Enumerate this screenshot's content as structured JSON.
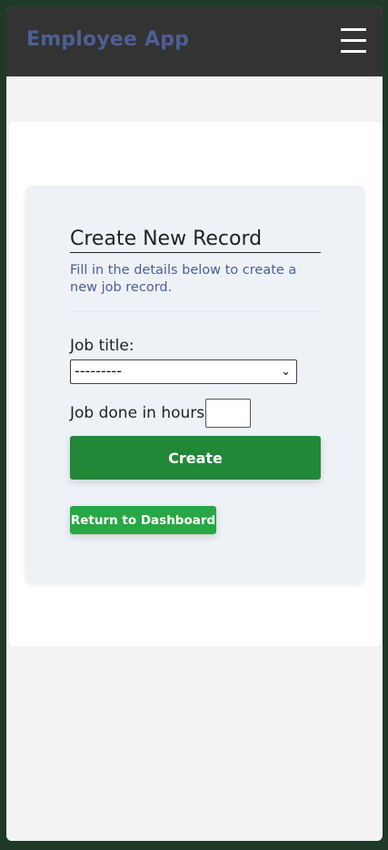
{
  "header": {
    "brand": "Employee App",
    "menu_icon": "hamburger-menu-icon"
  },
  "form": {
    "title": "Create New Record",
    "subtitle": "Fill in the details below to create a new job record.",
    "job_title_label": "Job title:",
    "job_title_selected": "---------",
    "hours_label": "Job done in hours:",
    "hours_value": "",
    "create_label": "Create",
    "return_label": "Return to Dashboard"
  },
  "colors": {
    "navbar": "#333333",
    "brand": "#4d5f93",
    "primary_button": "#218838",
    "secondary_button": "#28a745",
    "panel_bg": "#eef2f7",
    "page_border": "#1e3a27"
  }
}
